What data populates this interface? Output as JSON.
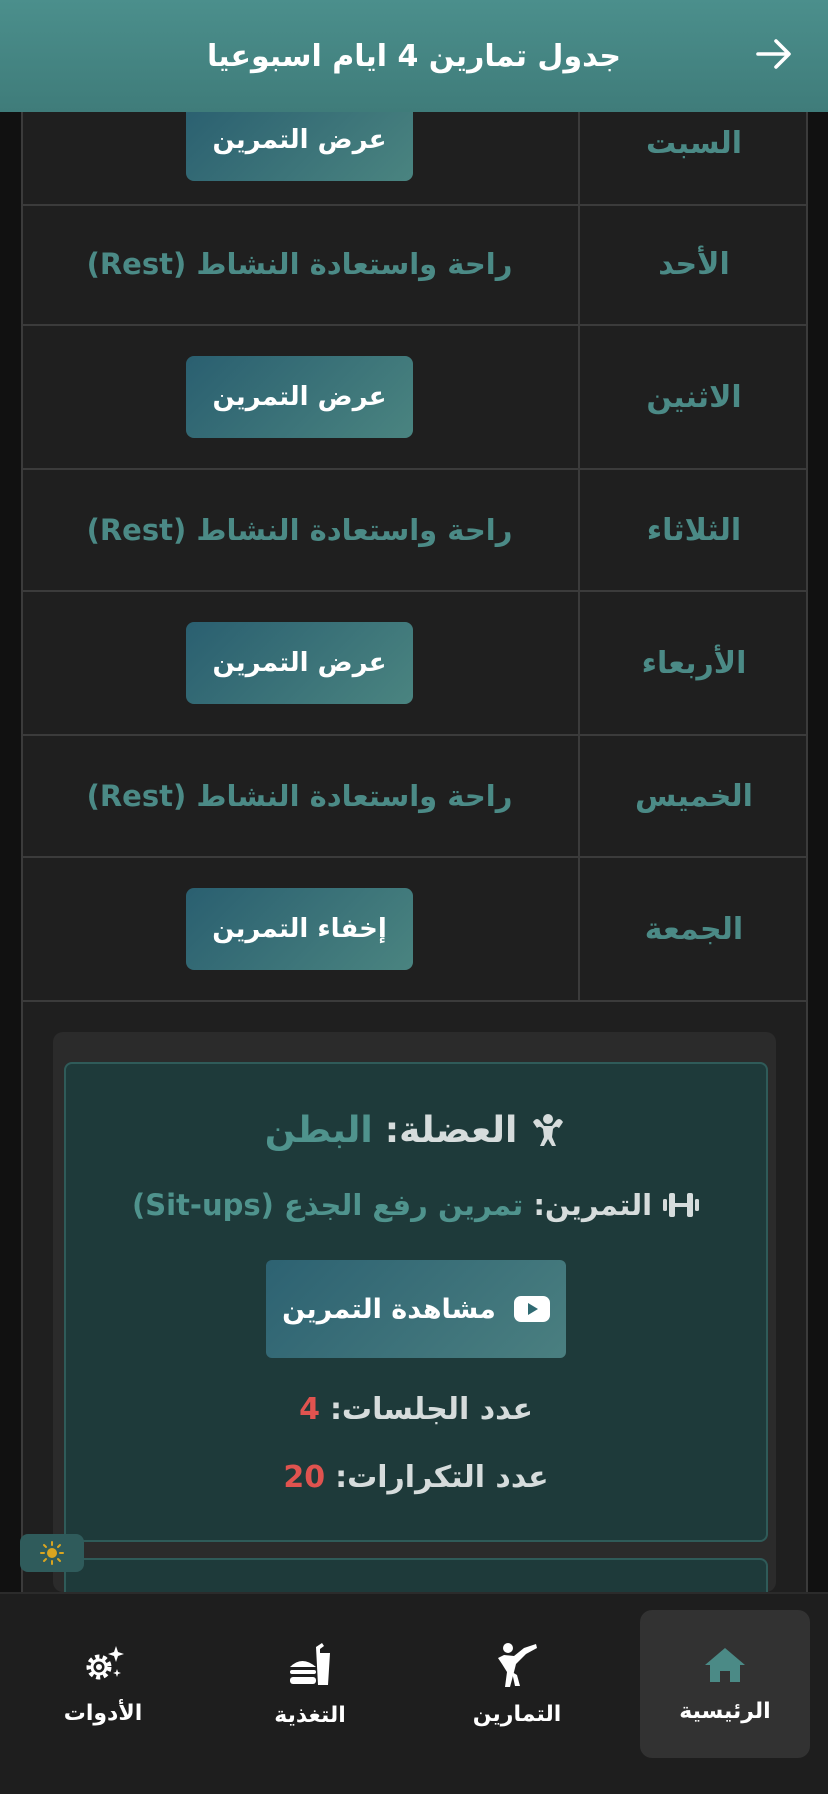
{
  "header": {
    "title": "جدول تمارين 4 ايام اسبوعيا",
    "back_icon": "arrow-right-icon"
  },
  "schedule": [
    {
      "day": "السبت",
      "type": "button",
      "content": "عرض التمرين"
    },
    {
      "day": "الأحد",
      "type": "rest",
      "content": "راحة واستعادة النشاط (Rest)"
    },
    {
      "day": "الاثنين",
      "type": "button",
      "content": "عرض التمرين"
    },
    {
      "day": "الثلاثاء",
      "type": "rest",
      "content": "راحة واستعادة النشاط (Rest)"
    },
    {
      "day": "الأربعاء",
      "type": "button",
      "content": "عرض التمرين"
    },
    {
      "day": "الخميس",
      "type": "rest",
      "content": "راحة واستعادة النشاط (Rest)"
    },
    {
      "day": "الجمعة",
      "type": "button",
      "content": "إخفاء التمرين"
    }
  ],
  "exercise_card": {
    "muscle_label": "العضلة:",
    "muscle_value": "البطن",
    "exercise_label": "التمرين:",
    "exercise_value": "تمرين رفع الجذع (Sit-ups)",
    "watch_label": "مشاهدة التمرين",
    "sets_label": "عدد الجلسات:",
    "sets_value": "4",
    "reps_label": "عدد التكرارات:",
    "reps_value": "20"
  },
  "colors": {
    "accent": "#4b8a86",
    "header": "#4b8f8c",
    "highlight": "#e0534f",
    "background": "#1f1f1f"
  },
  "bottom_nav": [
    {
      "label": "الرئيسية",
      "icon": "home-icon",
      "active": true
    },
    {
      "label": "التمارين",
      "icon": "martial-arts-icon",
      "active": false
    },
    {
      "label": "التغذية",
      "icon": "burger-drink-icon",
      "active": false
    },
    {
      "label": "الأدوات",
      "icon": "gear-sparkle-icon",
      "active": false
    }
  ]
}
